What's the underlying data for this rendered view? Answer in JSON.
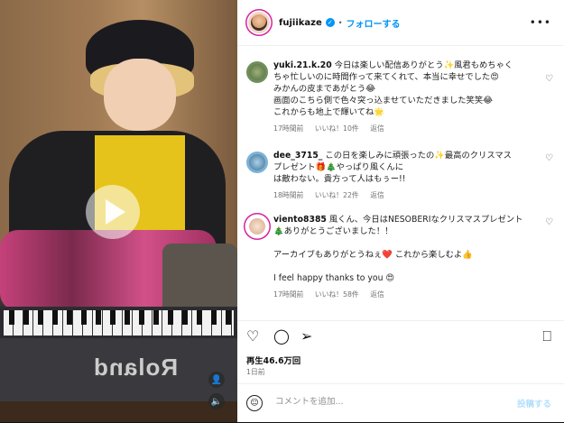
{
  "post": {
    "username": "fujiikaze",
    "follow_label": "フォローする",
    "more_label": "•••"
  },
  "comments": [
    {
      "username": "yuki.21.k.20",
      "lines": [
        "今日は楽しい配信ありがとう✨風君もめちゃく",
        "ちゃ忙しいのに時間作って来てくれて、本当に幸せでした😍",
        "みかんの皮まであがとう😂",
        "画面のこちら側で色々突っ込ませていただきました笑笑😂",
        "これからも地上で輝いてね🌟"
      ],
      "time": "17時間前",
      "likes": "いいね！10件",
      "reply": "返信"
    },
    {
      "username": "dee_3715_",
      "lines": [
        "この日を楽しみに頑張ったの✨最高のクリスマス",
        "プレゼント🎁🎄やっぱり風くんに",
        "は敵わない。貴方って人はもぅー!!"
      ],
      "time": "18時間前",
      "likes": "いいね！22件",
      "reply": "返信"
    },
    {
      "username": "viento8385",
      "lines": [
        "風くん、今日はNESOBERIなクリスマスプレゼント",
        "🎄ありがとうございました！！",
        "",
        "アーカイブもありがとうねぇ❤️ これから楽しむよ👍",
        "",
        "I feel happy thanks to you 😍"
      ],
      "time": "17時間前",
      "likes": "いいね！58件",
      "reply": "返信"
    }
  ],
  "stats": {
    "views": "再生46.6万回",
    "posted": "1日前"
  },
  "comment_box": {
    "placeholder": "コメントを追加...",
    "post_label": "投稿する"
  },
  "video": {
    "brand": "Roland"
  }
}
